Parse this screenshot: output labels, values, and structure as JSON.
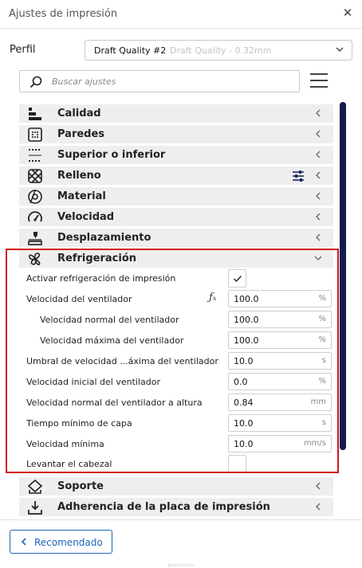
{
  "window": {
    "title": "Ajustes de impresión",
    "close_icon": "close-icon"
  },
  "profile": {
    "label": "Perfil",
    "name": "Draft Quality #2",
    "description": "Draft Quality - 0.32mm"
  },
  "search": {
    "placeholder": "Buscar ajustes"
  },
  "categories": {
    "calidad": "Calidad",
    "paredes": "Paredes",
    "superior": "Superior o inferior",
    "relleno": "Relleno",
    "material": "Material",
    "velocidad": "Velocidad",
    "desplazamiento": "Desplazamiento",
    "refrigeracion": "Refrigeración",
    "soporte": "Soporte",
    "adherencia": "Adherencia de la placa de impresión"
  },
  "cooling_settings": [
    {
      "label": "Activar refrigeración de impresión",
      "type": "checkbox",
      "checked": true
    },
    {
      "label": "Velocidad del ventilador",
      "value": "100.0",
      "unit": "%",
      "has_function": true
    },
    {
      "label": "Velocidad normal del ventilador",
      "value": "100.0",
      "unit": "%"
    },
    {
      "label": "Velocidad máxima del ventilador",
      "value": "100.0",
      "unit": "%"
    },
    {
      "label": "Umbral de velocidad ...áxima del ventilador",
      "value": "10.0",
      "unit": "s"
    },
    {
      "label": "Velocidad inicial del ventilador",
      "value": "0.0",
      "unit": "%"
    },
    {
      "label": "Velocidad normal del ventilador a altura",
      "value": "0.84",
      "unit": "mm"
    },
    {
      "label": "Tiempo mínimo de capa",
      "value": "10.0",
      "unit": "s"
    },
    {
      "label": "Velocidad mínima",
      "value": "10.0",
      "unit": "mm/s"
    },
    {
      "label": "Levantar el cabezal",
      "type": "checkbox",
      "checked": false
    }
  ],
  "footer": {
    "recommended_label": "Recomendado"
  },
  "colors": {
    "accent": "#1d66b7",
    "highlight": "#d6151d",
    "scrollbar": "#141a4c",
    "category_bg": "#eeeeee"
  }
}
